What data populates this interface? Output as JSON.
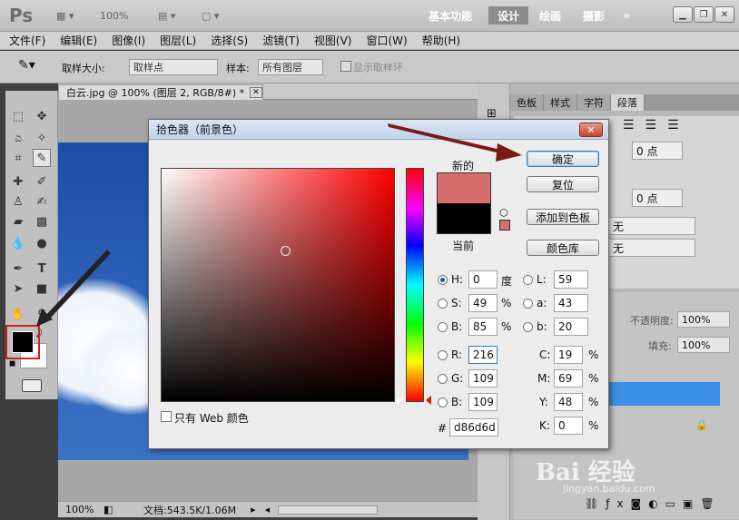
{
  "app": {
    "logo": "Ps",
    "zoom": "100%",
    "workspaces": [
      "基本功能",
      "设计",
      "绘画",
      "摄影"
    ],
    "more": "»"
  },
  "menu": [
    "文件(F)",
    "编辑(E)",
    "图像(I)",
    "图层(L)",
    "选择(S)",
    "滤镜(T)",
    "视图(V)",
    "窗口(W)",
    "帮助(H)"
  ],
  "options": {
    "sample_size_label": "取样大小:",
    "sample_size_value": "取样点",
    "sample_label": "样本:",
    "sample_value": "所有图层",
    "show_ring": "显示取样环"
  },
  "document": {
    "tab_title": "白云.jpg @ 100% (图层 2, RGB/8#) *",
    "zoom": "100%",
    "doc_size": "文档:543.5K/1.06M"
  },
  "panel": {
    "tabs": [
      "色板",
      "样式",
      "字符",
      "段落"
    ],
    "field1": "0 点",
    "field2": "0 点",
    "select1": "无",
    "select2": "无",
    "opacity_label": "不透明度:",
    "opacity_value": "100%",
    "fill_label": "填充:",
    "fill_value": "100%"
  },
  "dialog": {
    "title": "拾色器（前景色）",
    "close": "✕",
    "new_label": "新的",
    "current_label": "当前",
    "buttons": {
      "ok": "确定",
      "reset": "复位",
      "add_swatches": "添加到色板",
      "color_libraries": "颜色库"
    },
    "web_only": "只有 Web 颜色",
    "hsb": {
      "h_label": "H:",
      "h": "0",
      "h_unit": "度",
      "s_label": "S:",
      "s": "49",
      "s_unit": "%",
      "b_label": "B:",
      "b": "85",
      "b_unit": "%"
    },
    "rgb": {
      "r_label": "R:",
      "r": "216",
      "g_label": "G:",
      "g": "109",
      "b_label": "B:",
      "b": "109"
    },
    "lab": {
      "l_label": "L:",
      "l": "59",
      "a_label": "a:",
      "a": "43",
      "b_label": "b:",
      "b": "20"
    },
    "cmyk": {
      "c_label": "C:",
      "c": "19",
      "c_unit": "%",
      "m_label": "M:",
      "m": "69",
      "m_unit": "%",
      "y_label": "Y:",
      "y": "48",
      "y_unit": "%",
      "k_label": "K:",
      "k": "0",
      "k_unit": "%"
    },
    "hex_label": "#",
    "hex": "d86d6d",
    "colors": {
      "new": "#d86d6d",
      "current": "#000000"
    }
  },
  "watermark": {
    "text": "Bai 经验",
    "url": "jingyan.baidu.com"
  }
}
